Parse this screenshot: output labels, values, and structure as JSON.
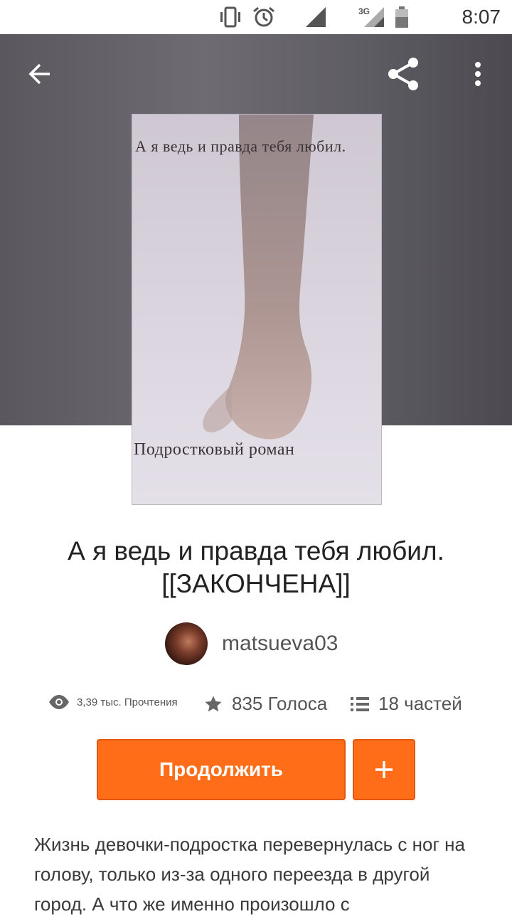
{
  "status_bar": {
    "time": "8:07",
    "network": "3G",
    "icons": [
      "vibrate-icon",
      "alarm-icon",
      "signal-icon",
      "signal-3g-icon",
      "battery-icon"
    ]
  },
  "app_bar": {
    "icons": [
      "back-arrow-icon",
      "share-icon",
      "more-vert-icon"
    ]
  },
  "cover": {
    "top_text": "А я ведь и правда тебя любил.",
    "bottom_text": "Подростковый роман"
  },
  "story": {
    "title": "А я ведь и правда тебя любил. [[ЗАКОНЧЕНА]]",
    "author": "matsueva03",
    "reads": "3,39 тыс. Прочтения",
    "votes": "835 Голоса",
    "parts": "18 частей",
    "description": "Жизнь девочки-подростка перевернулась с ног на голову, только из-за одного переезда в другой город. А что же именно произошло с"
  },
  "actions": {
    "continue_label": "Продолжить",
    "add_label": "+"
  },
  "colors": {
    "accent": "#ff6d19",
    "hero_bg": "#5e5c62"
  }
}
